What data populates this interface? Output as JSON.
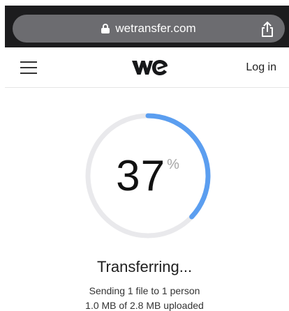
{
  "browser": {
    "url": "wetransfer.com"
  },
  "header": {
    "login_label": "Log in"
  },
  "transfer": {
    "progress_percent": 37,
    "progress_value": "37",
    "percent_sign": "%",
    "title": "Transferring...",
    "recipients_text": "Sending 1 file to 1 person",
    "size_text": "1.0 MB of 2.8 MB uploaded"
  },
  "colors": {
    "browser_bar": "#1c1c1e",
    "url_pill": "#6c6c70",
    "ring_track": "#e9e9ec",
    "ring_progress": "#5b9ef0",
    "text_primary": "#1f1f1f"
  }
}
